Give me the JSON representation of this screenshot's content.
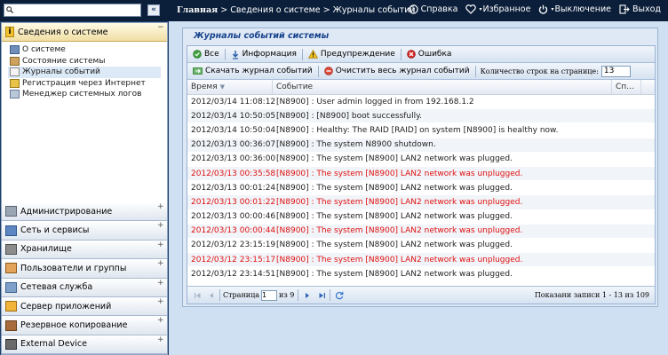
{
  "topbar": {
    "breadcrumb_home": "Главная",
    "breadcrumb_sep": ">",
    "breadcrumb_section": "Сведения о системе",
    "breadcrumb_page": "Журналы событий",
    "actions": {
      "help": "Справка",
      "favorites": "Избранное",
      "shutdown": "Выключение",
      "logout": "Выход"
    }
  },
  "sidebar": {
    "collapse_label": "«",
    "expand_symbol": "+",
    "collapse_symbol": "−",
    "active_section": "Сведения о системе",
    "sub_items": [
      {
        "label": "О системе",
        "icon": "monitor-icon"
      },
      {
        "label": "Состояние системы",
        "icon": "status-icon"
      },
      {
        "label": "Журналы событий",
        "icon": "log-icon",
        "selected": true
      },
      {
        "label": "Регистрация через Интернет",
        "icon": "card-icon"
      },
      {
        "label": "Менеджер системных логов",
        "icon": "logmanager-icon"
      }
    ],
    "sections": [
      {
        "label": "Администрирование",
        "icon": "tools-icon"
      },
      {
        "label": "Сеть и сервисы",
        "icon": "network-icon"
      },
      {
        "label": "Хранилище",
        "icon": "storage-icon"
      },
      {
        "label": "Пользователи и группы",
        "icon": "users-icon"
      },
      {
        "label": "Сетевая служба",
        "icon": "service-icon"
      },
      {
        "label": "Сервер приложений",
        "icon": "appserver-icon"
      },
      {
        "label": "Резервное копирование",
        "icon": "backup-icon"
      },
      {
        "label": "External Device",
        "icon": "device-icon"
      }
    ]
  },
  "panel": {
    "title": "Журналы событий системы",
    "filters": {
      "all": "Все",
      "info": "Информация",
      "warning": "Предупреждение",
      "error": "Ошибка"
    },
    "download": "Скачать журнал событий",
    "clear": "Очистить весь журнал событий",
    "rows_label": "Количество строк на странице:",
    "rows_value": "13",
    "columns": {
      "time": "Время",
      "event": "Событие",
      "sp": "Сп..."
    },
    "rows": [
      {
        "time": "2012/03/14 11:08:12",
        "event": "[N8900] : User admin logged in from 192.168.1.2",
        "level": "info"
      },
      {
        "time": "2012/03/14 10:50:05",
        "event": "[N8900] : [N8900] boot successfully.",
        "level": "info"
      },
      {
        "time": "2012/03/14 10:50:04",
        "event": "[N8900] : Healthy: The RAID [RAID] on system [N8900] is healthy now.",
        "level": "info"
      },
      {
        "time": "2012/03/13 00:36:07",
        "event": "[N8900] : The system N8900 shutdown.",
        "level": "info"
      },
      {
        "time": "2012/03/13 00:36:00",
        "event": "[N8900] : The system [N8900] LAN2 network was plugged.",
        "level": "info"
      },
      {
        "time": "2012/03/13 00:35:58",
        "event": "[N8900] : The system [N8900] LAN2 network was unplugged.",
        "level": "error"
      },
      {
        "time": "2012/03/13 00:01:24",
        "event": "[N8900] : The system [N8900] LAN2 network was plugged.",
        "level": "info"
      },
      {
        "time": "2012/03/13 00:01:22",
        "event": "[N8900] : The system [N8900] LAN2 network was unplugged.",
        "level": "error"
      },
      {
        "time": "2012/03/13 00:00:46",
        "event": "[N8900] : The system [N8900] LAN2 network was plugged.",
        "level": "info"
      },
      {
        "time": "2012/03/13 00:00:44",
        "event": "[N8900] : The system [N8900] LAN2 network was unplugged.",
        "level": "error"
      },
      {
        "time": "2012/03/12 23:15:19",
        "event": "[N8900] : The system [N8900] LAN2 network was plugged.",
        "level": "info"
      },
      {
        "time": "2012/03/12 23:15:17",
        "event": "[N8900] : The system [N8900] LAN2 network was unplugged.",
        "level": "error"
      },
      {
        "time": "2012/03/12 23:14:51",
        "event": "[N8900] : The system [N8900] LAN2 network was plugged.",
        "level": "info"
      }
    ],
    "pager": {
      "page_label": "Страница",
      "page_value": "1",
      "of_label": "из 9",
      "records": "Показани записи 1 - 13 из 109"
    }
  },
  "colors": {
    "topbar_bg": "#0b1f3a",
    "accent": "#15428b",
    "error_text": "#e01010",
    "active_section": "#f0dea4"
  }
}
